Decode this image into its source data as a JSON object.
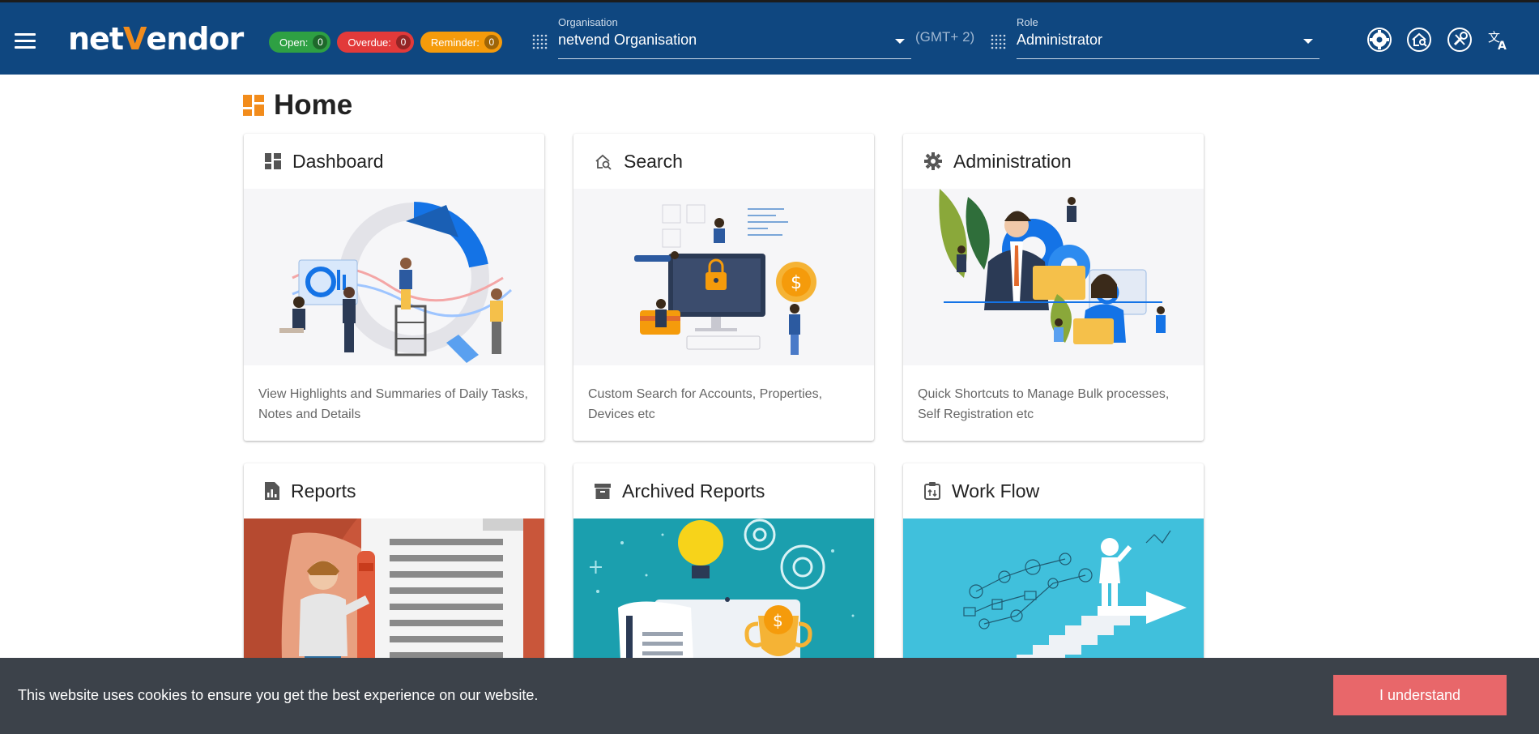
{
  "header": {
    "logo_text_a": "net",
    "logo_text_v": "V",
    "logo_text_b": "endor",
    "badges": [
      {
        "label": "Open:",
        "count": "0"
      },
      {
        "label": "Overdue:",
        "count": "0"
      },
      {
        "label": "Reminder:",
        "count": "0"
      }
    ],
    "organisation": {
      "label": "Organisation",
      "value": "netvend Organisation"
    },
    "timezone": "(GMT+ 2)",
    "role": {
      "label": "Role",
      "value": "Administrator"
    },
    "icons": [
      "settings-icon",
      "home-search-icon",
      "tools-icon",
      "translate-icon"
    ]
  },
  "page": {
    "title": "Home"
  },
  "cards": [
    {
      "title": "Dashboard",
      "icon": "dashboard-icon",
      "description": "View Highlights and Summaries of Daily Tasks, Notes and Details"
    },
    {
      "title": "Search",
      "icon": "search-icon",
      "description": "Custom Search for Accounts, Properties, Devices etc"
    },
    {
      "title": "Administration",
      "icon": "gear-icon",
      "description": "Quick Shortcuts to Manage Bulk processes, Self Registration etc"
    },
    {
      "title": "Reports",
      "icon": "report-icon",
      "description": ""
    },
    {
      "title": "Archived Reports",
      "icon": "archive-icon",
      "description": ""
    },
    {
      "title": "Work Flow",
      "icon": "workflow-icon",
      "description": ""
    }
  ],
  "cookie": {
    "message": "This website uses cookies to ensure you get the best experience on our website.",
    "button": "I understand"
  },
  "colors": {
    "header_bg": "#0f4780",
    "accent_orange": "#f28c1c",
    "open_green": "#2ea043",
    "overdue_red": "#e23a3a",
    "reminder_orange": "#f59b0b",
    "cookie_bg": "#3c424a",
    "cookie_button": "#e8676a"
  }
}
